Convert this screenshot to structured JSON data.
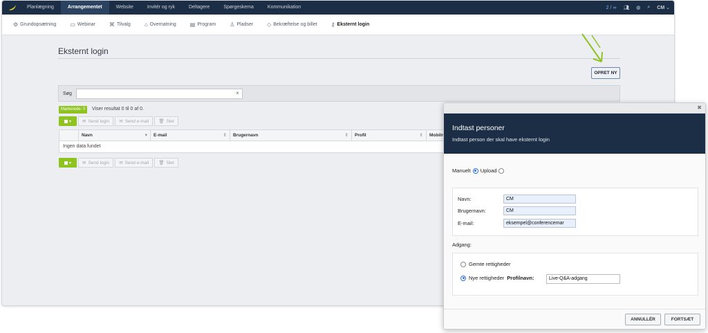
{
  "topnav": {
    "items": [
      "Planlægning",
      "Arrangementet",
      "Website",
      "Invitér og ryk",
      "Deltagere",
      "Spørgeskema",
      "Kommunikation"
    ],
    "active_index": 1,
    "counter": "2 / ∞",
    "user": "CM"
  },
  "subnav": {
    "items": [
      {
        "label": "Grundopsætning",
        "icon": "gear-icon"
      },
      {
        "label": "Webinar",
        "icon": "video-icon"
      },
      {
        "label": "Tilvalg",
        "icon": "addons-icon"
      },
      {
        "label": "Overnatning",
        "icon": "bed-icon"
      },
      {
        "label": "Program",
        "icon": "calendar-icon"
      },
      {
        "label": "Pladser",
        "icon": "seat-icon"
      },
      {
        "label": "Bekræftelse og billet",
        "icon": "ticket-icon"
      },
      {
        "label": "Eksternt login",
        "icon": "key-icon"
      }
    ],
    "active_index": 7
  },
  "page": {
    "title": "Eksternt login",
    "create_button": "OPRET NY",
    "search_label": "Søg",
    "search_value": "",
    "selected_badge": "Markerede: 0",
    "result_info": "Viser resultat 0 til 0 af 0.",
    "actions": {
      "send_login": "Send login",
      "send_email": "Send e-mail",
      "delete": "Slet"
    },
    "columns": [
      "Navn",
      "E-mail",
      "Brugernavn",
      "Profil",
      "Mobilnu"
    ],
    "empty_text": "Ingen data fundet"
  },
  "modal": {
    "title": "Indtast personer",
    "subtitle": "Indtast person der skal have eksternt login",
    "mode_manual": "Manuelt",
    "mode_upload": "Upload",
    "mode_selected": "manual",
    "labels": {
      "name": "Navn:",
      "username": "Brugernavn:",
      "email": "E-mail:"
    },
    "values": {
      "name": "CM",
      "username": "CM",
      "email": "eksempel@conferencemar"
    },
    "access_label": "Adgang:",
    "saved_rights": "Gemte rettigheder",
    "new_rights": "Nye rettigheder",
    "profile_label": "Profilnavn:",
    "profile_value": "Live-Q&A-adgang",
    "access_selected": "new",
    "cancel": "ANNULLÉR",
    "continue": "FORTSÆT"
  },
  "colors": {
    "navy": "#1b2e45",
    "accent_green": "#8fc31f",
    "arrow_green": "#8fc31f"
  }
}
